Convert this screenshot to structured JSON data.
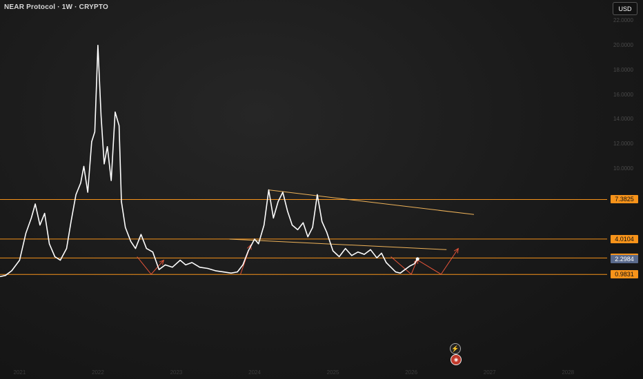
{
  "header": {
    "title": "NEAR Protocol · 1W · CRYPTO",
    "currency": "USD"
  },
  "price_tags": [
    {
      "label": "7.3825",
      "value": 7.3825,
      "style": "orange"
    },
    {
      "label": "4.0104",
      "value": 4.0104,
      "style": "orange"
    },
    {
      "label": "2.3908",
      "value": 2.3908,
      "style": "orange"
    },
    {
      "label": "2.2984",
      "value": 2.2984,
      "style": "blue"
    },
    {
      "label": "0.9831",
      "value": 0.9831,
      "style": "orange"
    }
  ],
  "colors": {
    "price_line": "#ffffff",
    "level_line": "#f7931a",
    "trend_line": "#f0b45a",
    "arrow": "#e8553a",
    "current_tag": "#5a6a8c"
  },
  "icons": [
    "bolt-icon",
    "flag-icon"
  ],
  "chart_data": {
    "type": "line",
    "title": "NEAR Protocol · 1W · CRYPTO",
    "ylim": [
      0,
      22
    ],
    "y_ticks": [
      "22.0000",
      "20.0000",
      "18.0000",
      "16.0000",
      "14.0000",
      "12.0000",
      "10.0000"
    ],
    "x_ticks": [
      "2021",
      "2022",
      "2023",
      "2024",
      "2025",
      "2026",
      "2027",
      "2028"
    ],
    "x_range": [
      2020.75,
      2028.5
    ],
    "grid": false,
    "series": [
      {
        "values": [
          [
            2020.75,
            0.8
          ],
          [
            2020.82,
            0.9
          ],
          [
            2020.9,
            1.3
          ],
          [
            2021.0,
            2.2
          ],
          [
            2021.08,
            4.5
          ],
          [
            2021.15,
            5.8
          ],
          [
            2021.2,
            7.0
          ],
          [
            2021.26,
            5.2
          ],
          [
            2021.32,
            6.2
          ],
          [
            2021.38,
            3.6
          ],
          [
            2021.45,
            2.5
          ],
          [
            2021.52,
            2.2
          ],
          [
            2021.6,
            3.2
          ],
          [
            2021.66,
            5.6
          ],
          [
            2021.72,
            7.8
          ],
          [
            2021.78,
            8.8
          ],
          [
            2021.82,
            10.2
          ],
          [
            2021.87,
            8.0
          ],
          [
            2021.92,
            12.2
          ],
          [
            2021.96,
            13.0
          ],
          [
            2022.0,
            20.0
          ],
          [
            2022.04,
            14.3
          ],
          [
            2022.08,
            10.4
          ],
          [
            2022.12,
            11.8
          ],
          [
            2022.17,
            9.0
          ],
          [
            2022.22,
            14.6
          ],
          [
            2022.27,
            13.5
          ],
          [
            2022.3,
            7.2
          ],
          [
            2022.35,
            5.0
          ],
          [
            2022.42,
            3.8
          ],
          [
            2022.48,
            3.2
          ],
          [
            2022.55,
            4.4
          ],
          [
            2022.62,
            3.2
          ],
          [
            2022.7,
            2.9
          ],
          [
            2022.78,
            1.4
          ],
          [
            2022.86,
            1.8
          ],
          [
            2022.95,
            1.6
          ],
          [
            2023.05,
            2.2
          ],
          [
            2023.12,
            1.8
          ],
          [
            2023.2,
            2.0
          ],
          [
            2023.3,
            1.6
          ],
          [
            2023.4,
            1.5
          ],
          [
            2023.5,
            1.3
          ],
          [
            2023.6,
            1.2
          ],
          [
            2023.7,
            1.1
          ],
          [
            2023.78,
            1.2
          ],
          [
            2023.85,
            1.8
          ],
          [
            2023.92,
            3.0
          ],
          [
            2024.0,
            4.0
          ],
          [
            2024.05,
            3.6
          ],
          [
            2024.12,
            5.2
          ],
          [
            2024.18,
            8.2
          ],
          [
            2024.24,
            5.8
          ],
          [
            2024.3,
            7.2
          ],
          [
            2024.36,
            8.0
          ],
          [
            2024.42,
            6.4
          ],
          [
            2024.48,
            5.2
          ],
          [
            2024.55,
            4.8
          ],
          [
            2024.62,
            5.4
          ],
          [
            2024.68,
            4.2
          ],
          [
            2024.74,
            5.0
          ],
          [
            2024.8,
            7.8
          ],
          [
            2024.86,
            5.5
          ],
          [
            2024.92,
            4.6
          ],
          [
            2025.0,
            3.0
          ],
          [
            2025.08,
            2.5
          ],
          [
            2025.16,
            3.2
          ],
          [
            2025.24,
            2.6
          ],
          [
            2025.32,
            2.9
          ],
          [
            2025.4,
            2.7
          ],
          [
            2025.48,
            3.1
          ],
          [
            2025.56,
            2.4
          ],
          [
            2025.62,
            2.8
          ],
          [
            2025.68,
            2.0
          ],
          [
            2025.74,
            1.6
          ],
          [
            2025.8,
            1.2
          ],
          [
            2025.86,
            1.1
          ],
          [
            2025.92,
            1.4
          ],
          [
            2025.98,
            1.7
          ],
          [
            2026.04,
            1.9
          ],
          [
            2026.08,
            2.3
          ]
        ]
      }
    ],
    "horizontal_levels": [
      7.3825,
      4.0104,
      2.3908,
      0.9831
    ],
    "trendlines": [
      {
        "from": [
          2024.18,
          8.2
        ],
        "to": [
          2026.8,
          6.1
        ]
      },
      {
        "from": [
          2023.68,
          4.0
        ],
        "to": [
          2026.45,
          3.1
        ]
      }
    ],
    "arrows": [
      {
        "points": [
          [
            2022.5,
            2.5
          ],
          [
            2022.68,
            1.0
          ],
          [
            2022.84,
            2.2
          ]
        ]
      },
      {
        "points": [
          [
            2023.82,
            1.0
          ],
          [
            2023.95,
            3.5
          ]
        ]
      },
      {
        "points": [
          [
            2025.74,
            2.5
          ],
          [
            2026.0,
            1.0
          ],
          [
            2026.08,
            2.3
          ]
        ]
      },
      {
        "points": [
          [
            2026.06,
            2.3
          ],
          [
            2026.38,
            1.0
          ],
          [
            2026.6,
            3.2
          ]
        ]
      }
    ],
    "current_value": 2.2984
  }
}
